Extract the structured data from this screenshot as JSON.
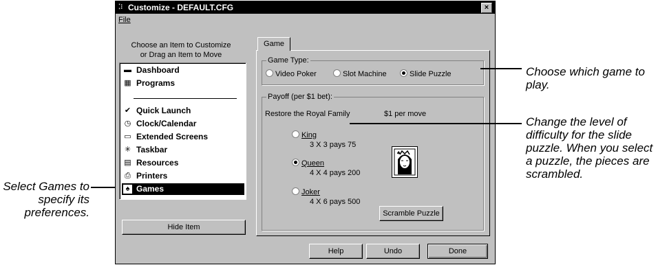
{
  "window": {
    "title": "Customize - DEFAULT.CFG",
    "close_glyph": "×"
  },
  "menu": {
    "file": "File"
  },
  "left": {
    "header_line1": "Choose an Item to Customize",
    "header_line2": "or Drag an Item to Move",
    "items": [
      {
        "label": "Dashboard",
        "icon": "dashboard-icon",
        "glyph": "▬"
      },
      {
        "label": "Programs",
        "icon": "programs-icon",
        "glyph": "▦"
      },
      {
        "label": "Quick Launch",
        "icon": "quick-launch-icon",
        "glyph": "✔"
      },
      {
        "label": "Clock/Calendar",
        "icon": "clock-icon",
        "glyph": "◷"
      },
      {
        "label": "Extended Screens",
        "icon": "extended-screens-icon",
        "glyph": "▭"
      },
      {
        "label": "Taskbar",
        "icon": "taskbar-icon",
        "glyph": "✳"
      },
      {
        "label": "Resources",
        "icon": "resources-icon",
        "glyph": "▤"
      },
      {
        "label": "Printers",
        "icon": "printer-icon",
        "glyph": "⎙"
      },
      {
        "label": "Games",
        "icon": "games-icon",
        "glyph": "♠"
      }
    ],
    "selected": "Games",
    "hide_button": "Hide Item"
  },
  "tab": {
    "label": "Game"
  },
  "game_type": {
    "title": "Game Type:",
    "options": [
      "Video Poker",
      "Slot Machine",
      "Slide Puzzle"
    ],
    "selected": "Slide Puzzle"
  },
  "payoff": {
    "title": "Payoff (per $1 bet):",
    "description": "Restore the Royal Family",
    "rate": "$1 per move",
    "levels": [
      {
        "label": "King",
        "detail": "3 X 3 pays 75"
      },
      {
        "label": "Queen",
        "detail": "4 X 4 pays 200"
      },
      {
        "label": "Joker",
        "detail": "4 X 6 pays 500"
      }
    ],
    "selected": "Queen",
    "scramble_button": "Scramble Puzzle"
  },
  "buttons": {
    "help": "Help",
    "undo": "Undo",
    "done": "Done"
  },
  "callouts": {
    "game_choice": "Choose which game to play.",
    "difficulty": "Change the level of difficulty for the slide puzzle. When you select a puzzle, the pieces are scrambled.",
    "games_item": "Select Games to specify its preferences."
  }
}
